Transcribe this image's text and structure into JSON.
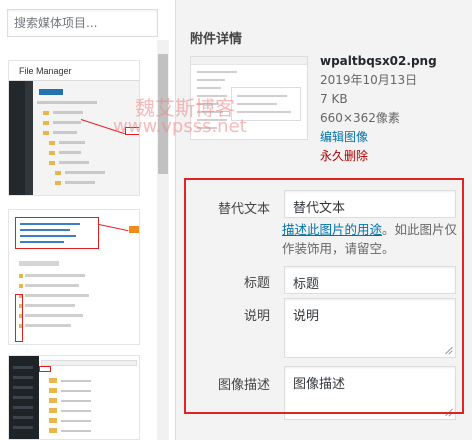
{
  "library": {
    "search_placeholder": "搜索媒体项目...",
    "thumbnails": [
      {
        "title": "File Manager"
      },
      {
        "title": ""
      },
      {
        "title": ""
      }
    ]
  },
  "details": {
    "heading": "附件详情",
    "filename": "wpaltbqsx02.png",
    "date": "2019年10月13日",
    "filesize": "7 KB",
    "dimensions": "660×362像素",
    "edit_link": "编辑图像",
    "delete_link": "永久删除"
  },
  "form": {
    "alt_label": "替代文本",
    "alt_value": "替代文本",
    "alt_hint_link": "描述此图片的用途",
    "alt_hint_rest": "。如此图片仅作装饰用，请留空。",
    "title_label": "标题",
    "title_value": "标题",
    "caption_label": "说明",
    "caption_value": "说明",
    "description_label": "图像描述",
    "description_value": "图像描述"
  },
  "watermark": {
    "line1": "魏艾斯博客",
    "line2": "www.vpsss.net"
  },
  "colors": {
    "link": "#0073aa",
    "delete": "#aa0000",
    "highlight": "#e02424"
  }
}
